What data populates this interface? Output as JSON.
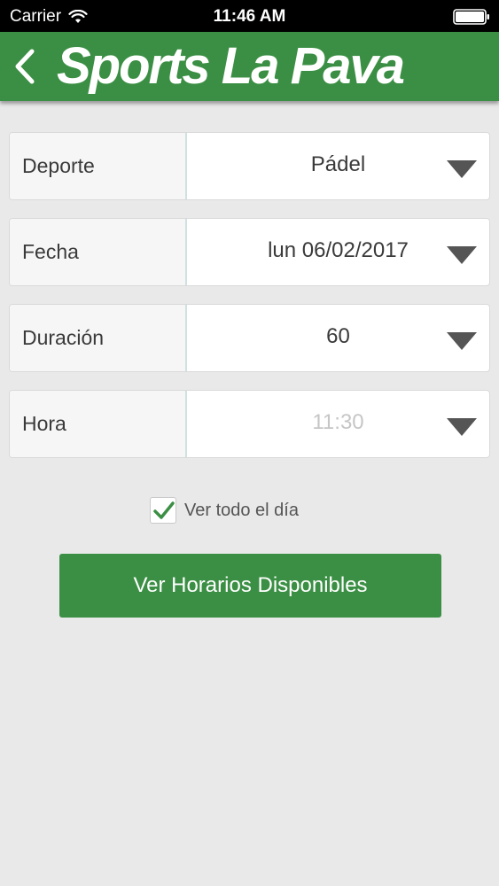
{
  "status_bar": {
    "carrier": "Carrier",
    "time": "11:46 AM"
  },
  "header": {
    "title": "Sports La Pava",
    "back_icon": "chevron-left-icon"
  },
  "form": {
    "deporte": {
      "label": "Deporte",
      "value": "Pádel"
    },
    "fecha": {
      "label": "Fecha",
      "value": "lun 06/02/2017"
    },
    "duracion": {
      "label": "Duración",
      "value": "60"
    },
    "hora": {
      "label": "Hora",
      "value": "11:30"
    }
  },
  "options": {
    "ver_todo_el_dia": {
      "label": "Ver todo el día",
      "checked": true
    }
  },
  "actions": {
    "submit_label": "Ver Horarios Disponibles"
  },
  "colors": {
    "brand_green": "#3b8f44",
    "background": "#e9e9e9",
    "text": "#3a3a3a",
    "placeholder": "#c6c6c6"
  }
}
